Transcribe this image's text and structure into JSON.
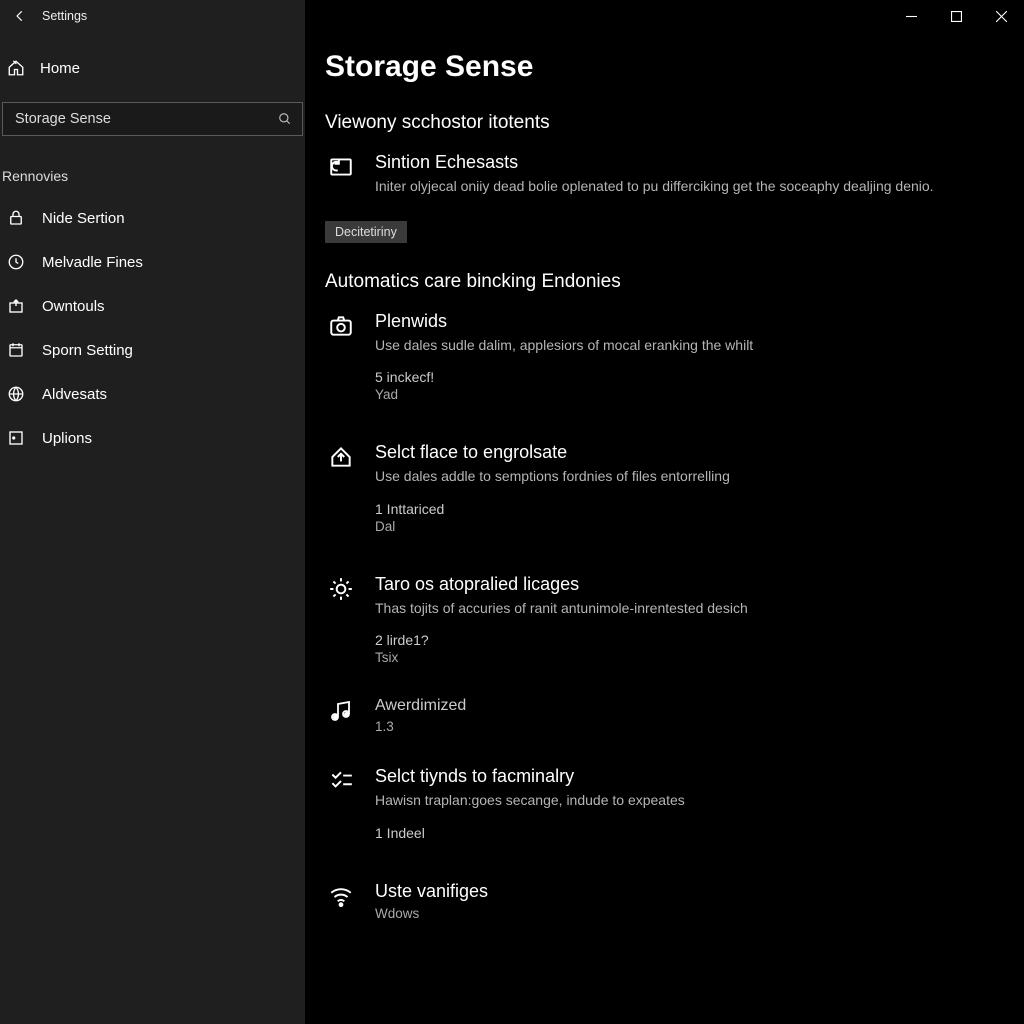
{
  "titlebar": {
    "title": "Settings"
  },
  "sidebar": {
    "home": "Home",
    "search_value": "Storage Sense",
    "group_label": "Rennovies",
    "items": [
      {
        "label": "Nide Sertion",
        "icon": "lock-icon"
      },
      {
        "label": "Melvadle Fines",
        "icon": "clock-icon"
      },
      {
        "label": "Owntouls",
        "icon": "box-arrow-icon"
      },
      {
        "label": "Sporn Setting",
        "icon": "calendar-icon"
      },
      {
        "label": "Aldvesats",
        "icon": "globe-icon"
      },
      {
        "label": "Uplions",
        "icon": "square-dot-icon"
      }
    ]
  },
  "main": {
    "title": "Storage Sense",
    "section1": {
      "heading": "Viewony scchostor itotents",
      "item": {
        "title": "Sintion Echesasts",
        "desc": "Initer olyjecal oniiy dead bolie oplenated to pu differciking get the soceaphy dealjing denio."
      },
      "button": "Decitetiriny"
    },
    "section2": {
      "heading": "Automatics care bincking Endonies",
      "items": [
        {
          "icon": "camera-icon",
          "title": "Plenwids",
          "desc": "Use dales sudle dalim, applesiors of mocal eranking the whilt",
          "meta1": "5 inckecf!",
          "meta2": "Yad"
        },
        {
          "icon": "house-up-icon",
          "title": "Selct flace to engrolsate",
          "desc": "Use dales addle to semptions fordnies of files entorrelling",
          "meta1": "1 Inttariced",
          "meta2": "Dal"
        },
        {
          "icon": "gear-dots-icon",
          "title": "Taro os atopralied licages",
          "desc": "Thas tojits of accuries of ranit antunimole-inrentested desich",
          "meta1": "2 lirde1?",
          "meta2": "Tsix"
        },
        {
          "icon": "music-icon",
          "title": "Awerdimized",
          "desc": "",
          "meta1": "1.3",
          "meta2": ""
        },
        {
          "icon": "checklist-icon",
          "title": "Selct tiynds to facminalry",
          "desc": "Hawisn traplan:goes secange, indude to expeates",
          "meta1": "1 Indeel",
          "meta2": ""
        },
        {
          "icon": "wifi-icon",
          "title": "Uste vanifiges",
          "desc": "Wdows",
          "meta1": "",
          "meta2": ""
        }
      ]
    }
  }
}
